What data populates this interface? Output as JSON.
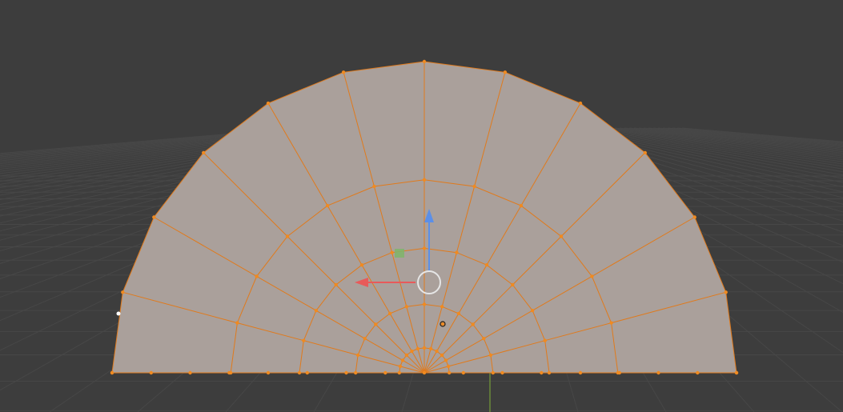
{
  "viewport": {
    "background_color": "#3d3d3d",
    "grid_color": "#474747",
    "grid_visible": true
  },
  "mesh": {
    "shape": "half-disc",
    "selection_state": "all-selected",
    "face_color": "#aaa09b",
    "edge_color": "#e07a1c",
    "vertex_color": "#f08a20"
  },
  "gizmo": {
    "x_axis_color": "#e85a5a",
    "z_axis_color": "#5b8fe8",
    "plane_handle_color": "#7fb56a",
    "center_handle_color": "#e6e6e6"
  },
  "axis_line": {
    "color": "#6a8a3a"
  },
  "icons": {
    "pivot": "pivot-point-icon",
    "cursor": "vertex-cursor-icon"
  }
}
